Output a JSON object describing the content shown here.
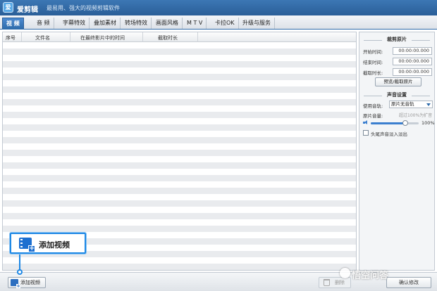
{
  "app": {
    "logo_text": "爱",
    "title": "爱剪辑",
    "tagline": "最易用、强大的视频剪辑软件"
  },
  "tabs": [
    {
      "label": "视 频",
      "active": true
    },
    {
      "label": "音 频"
    },
    {
      "label": "字幕特效"
    },
    {
      "label": "叠加素材"
    },
    {
      "label": "转场特效"
    },
    {
      "label": "画面风格"
    },
    {
      "label": "M T V"
    },
    {
      "label": "卡拉OK"
    },
    {
      "label": "升级与服务"
    }
  ],
  "file_list": {
    "columns": [
      "序号",
      "文件名",
      "在最终影片中的时间",
      "截取时长"
    ],
    "rows": []
  },
  "right_panel": {
    "clip_section": {
      "title": "裁剪原片",
      "start_label": "开始时间:",
      "start_value": "00:00:00.000",
      "end_label": "结束时间:",
      "end_value": "00:00:00.000",
      "duration_label": "截取时长:",
      "duration_value": "00:00:00.000",
      "preview_button": "预览/截取原片"
    },
    "audio_section": {
      "title": "声音设置",
      "track_label": "使用音轨:",
      "track_value": "原片无音轨",
      "volume_label": "原片音量:",
      "volume_hint": "超过100%为扩音",
      "volume_percent": "100%",
      "volume_fraction": 0.72,
      "fade_label": "头尾声音淡入淡出",
      "fade_checked": false
    }
  },
  "bottom_bar": {
    "add_video_button": "添加视频",
    "delete_button": "删除",
    "export_button": "确认修改"
  },
  "callout": {
    "text": "添加视频"
  },
  "watermark": {
    "text": "悟空问答"
  }
}
